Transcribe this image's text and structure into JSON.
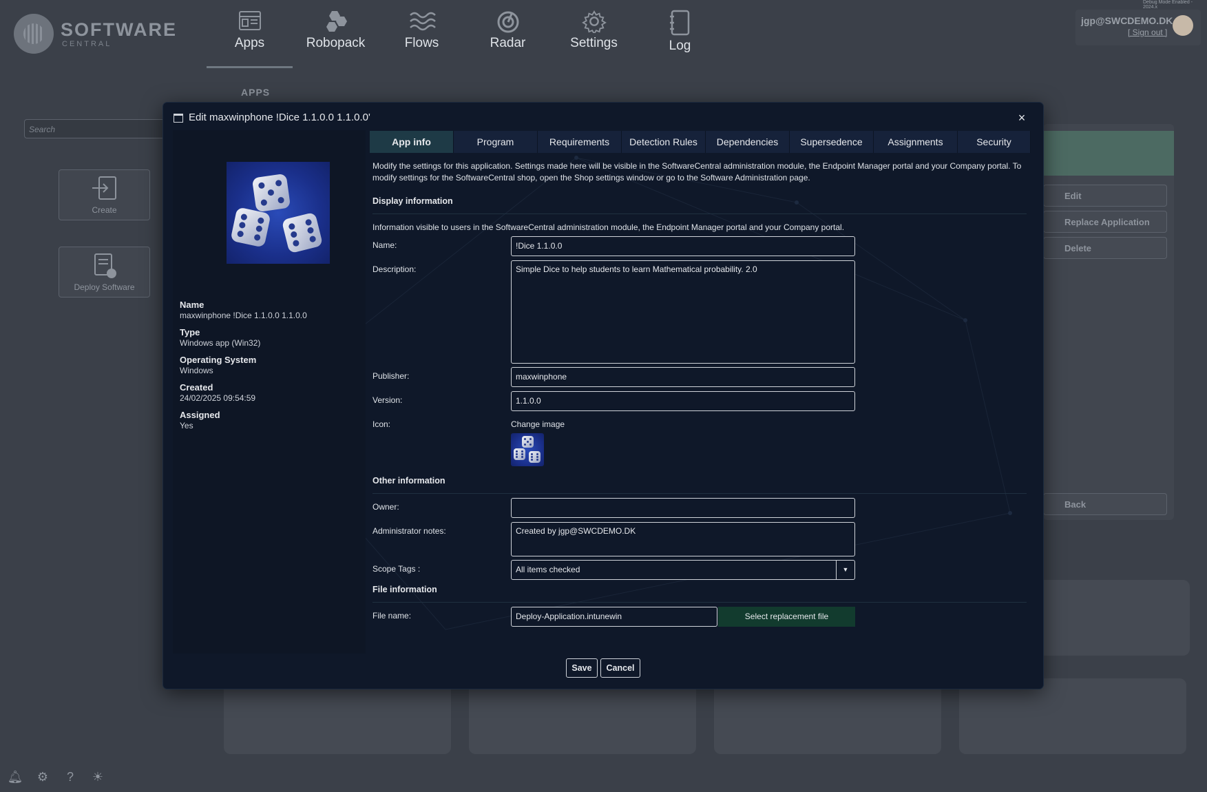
{
  "debug": "Debug Mode Enabled - 2024.x",
  "brand": {
    "name": "SOFTWARE",
    "sub": "CENTRAL"
  },
  "nav": [
    {
      "label": "Apps",
      "icon": "apps-icon"
    },
    {
      "label": "Robopack",
      "icon": "robopack-icon"
    },
    {
      "label": "Flows",
      "icon": "flows-icon"
    },
    {
      "label": "Radar",
      "icon": "radar-icon"
    },
    {
      "label": "Settings",
      "icon": "gear-icon"
    },
    {
      "label": "Log",
      "icon": "log-icon"
    }
  ],
  "section_header": "APPS",
  "user": {
    "email": "jgp@SWCDEMO.DK",
    "signout": "[ Sign out ]"
  },
  "bg_search": {
    "placeholder": "Search"
  },
  "side_buttons": {
    "create": "Create",
    "deploy": "Deploy Software"
  },
  "right_actions": {
    "edit": "Edit",
    "replace": "Replace Application",
    "delete": "Delete",
    "back": "Back"
  },
  "modal": {
    "title": "Edit maxwinphone !Dice 1.1.0.0 1.1.0.0'",
    "close": "×",
    "info": [
      {
        "label": "Name",
        "value": "maxwinphone !Dice 1.1.0.0 1.1.0.0"
      },
      {
        "label": "Type",
        "value": "Windows app (Win32)"
      },
      {
        "label": "Operating System",
        "value": "Windows"
      },
      {
        "label": "Created",
        "value": "24/02/2025 09:54:59"
      },
      {
        "label": "Assigned",
        "value": "Yes"
      }
    ],
    "tabs": [
      "App info",
      "Program",
      "Requirements",
      "Detection Rules",
      "Dependencies",
      "Supersedence",
      "Assignments",
      "Security"
    ],
    "active_tab": "App info",
    "intro": "Modify the settings for this application. Settings made here will be visible in the SoftwareCentral administration module, the Endpoint Manager portal and your Company portal. To modify settings for the SoftwareCentral shop, open the Shop settings window or go to the Software Administration page.",
    "display_info": {
      "heading": "Display information",
      "note": "Information visible to users in the SoftwareCentral administration module, the Endpoint Manager portal and your Company portal.",
      "name_label": "Name:",
      "name_value": "!Dice 1.1.0.0",
      "description_label": "Description:",
      "description_value": "Simple Dice to help students to learn Mathematical probability. 2.0",
      "publisher_label": "Publisher:",
      "publisher_value": "maxwinphone",
      "version_label": "Version:",
      "version_value": "1.1.0.0",
      "icon_label": "Icon:",
      "change_image": "Change image"
    },
    "other_info": {
      "heading": "Other information",
      "owner_label": "Owner:",
      "owner_value": "",
      "notes_label": "Administrator notes:",
      "notes_value": "Created by jgp@SWCDEMO.DK",
      "scope_label": "Scope Tags :",
      "scope_value": "All items checked"
    },
    "file_info": {
      "heading": "File information",
      "file_label": "File name:",
      "file_value": "Deploy-Application.intunewin",
      "select_button": "Select replacement file"
    },
    "save": "Save",
    "cancel": "Cancel"
  },
  "colors": {
    "modal_bg": "#0f1829",
    "active_tab": "#1e3a46",
    "select_button": "#123b2e",
    "backdrop": "#3b4049"
  }
}
